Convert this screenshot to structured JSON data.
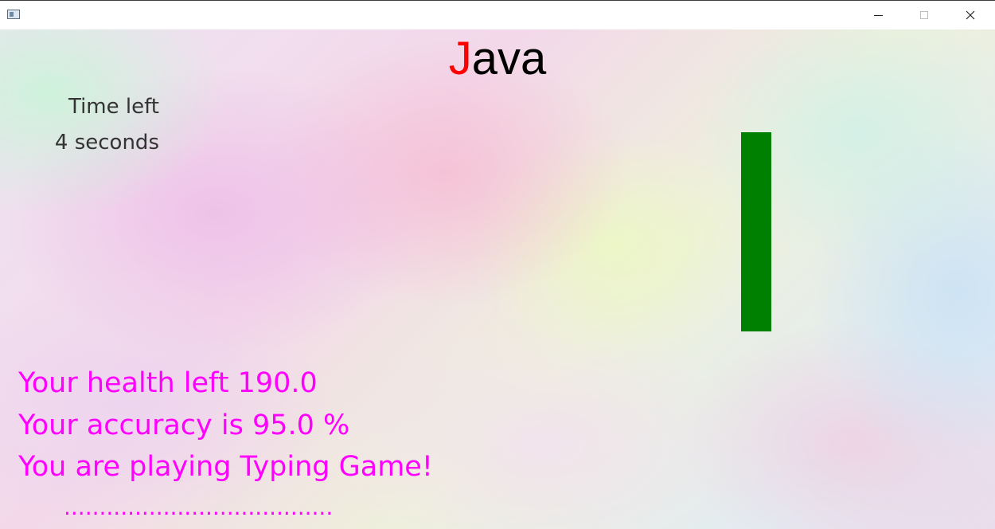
{
  "window": {
    "title": "",
    "icon": "app-window-icon",
    "controls": {
      "minimize": "minimize-icon",
      "maximize": "maximize-icon",
      "close": "close-icon"
    }
  },
  "game": {
    "word": {
      "typed": "J",
      "remaining": "ava"
    },
    "time_label": "Time left",
    "time_value": "4 seconds",
    "health_bar": {
      "fraction": 1.0,
      "color": "#008000"
    },
    "health_text": "Your health left 190.0",
    "accuracy_text": "Your accuracy is 95.0 %",
    "mode_text": "You are playing Typing Game!",
    "input_display": "......................................",
    "colors": {
      "typed": "#ff0000",
      "stats": "#ff00ff",
      "word": "#000000"
    }
  }
}
